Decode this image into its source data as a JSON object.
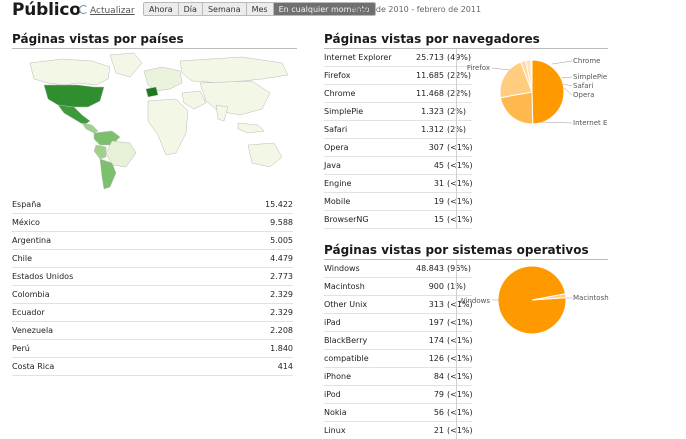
{
  "header": {
    "title": "Público",
    "refresh_label": "Actualizar",
    "range_buttons": [
      "Ahora",
      "Día",
      "Semana",
      "Mes",
      "En cualquier momento"
    ],
    "active_range": "En cualquier momento",
    "date_range": "mayo de 2010 - febrero de 2011"
  },
  "countries": {
    "title": "Páginas vistas por países",
    "rows": [
      {
        "name": "España",
        "value": "15.422"
      },
      {
        "name": "México",
        "value": "9.588"
      },
      {
        "name": "Argentina",
        "value": "5.005"
      },
      {
        "name": "Chile",
        "value": "4.479"
      },
      {
        "name": "Estados Unidos",
        "value": "2.773"
      },
      {
        "name": "Colombia",
        "value": "2.329"
      },
      {
        "name": "Ecuador",
        "value": "2.329"
      },
      {
        "name": "Venezuela",
        "value": "2.208"
      },
      {
        "name": "Perú",
        "value": "1.840"
      },
      {
        "name": "Costa Rica",
        "value": "414"
      }
    ]
  },
  "browsers": {
    "title": "Páginas vistas por navegadores",
    "rows": [
      {
        "name": "Internet Explorer",
        "count": "25.713",
        "pct": "(49%)"
      },
      {
        "name": "Firefox",
        "count": "11.685",
        "pct": "(22%)"
      },
      {
        "name": "Chrome",
        "count": "11.468",
        "pct": "(22%)"
      },
      {
        "name": "SimplePie",
        "count": "1.323",
        "pct": "(2%)"
      },
      {
        "name": "Safari",
        "count": "1.312",
        "pct": "(2%)"
      },
      {
        "name": "Opera",
        "count": "307",
        "pct": "(<1%)"
      },
      {
        "name": "Java",
        "count": "45",
        "pct": "(<1%)"
      },
      {
        "name": "Engine",
        "count": "31",
        "pct": "(<1%)"
      },
      {
        "name": "Mobile",
        "count": "19",
        "pct": "(<1%)"
      },
      {
        "name": "BrowserNG",
        "count": "15",
        "pct": "(<1%)"
      }
    ],
    "pie_labels": [
      "Firefox",
      "Chrome",
      "SimplePie",
      "Safari",
      "Opera",
      "Internet E"
    ]
  },
  "os": {
    "title": "Páginas vistas por sistemas operativos",
    "rows": [
      {
        "name": "Windows",
        "count": "48.843",
        "pct": "(96%)"
      },
      {
        "name": "Macintosh",
        "count": "900",
        "pct": "(1%)"
      },
      {
        "name": "Other Unix",
        "count": "313",
        "pct": "(<1%)"
      },
      {
        "name": "iPad",
        "count": "197",
        "pct": "(<1%)"
      },
      {
        "name": "BlackBerry",
        "count": "174",
        "pct": "(<1%)"
      },
      {
        "name": "compatible",
        "count": "126",
        "pct": "(<1%)"
      },
      {
        "name": "iPhone",
        "count": "84",
        "pct": "(<1%)"
      },
      {
        "name": "iPod",
        "count": "79",
        "pct": "(<1%)"
      },
      {
        "name": "Nokia",
        "count": "56",
        "pct": "(<1%)"
      },
      {
        "name": "Linux",
        "count": "21",
        "pct": "(<1%)"
      }
    ],
    "pie_labels": [
      "Windows",
      "Macintosh"
    ]
  },
  "chart_data": [
    {
      "type": "pie",
      "title": "",
      "categories": [
        "Internet Explorer",
        "Firefox",
        "Chrome",
        "SimplePie",
        "Safari",
        "Opera"
      ],
      "values": [
        25713,
        11685,
        11468,
        1323,
        1312,
        307
      ],
      "colors": [
        "#ff9900",
        "#ffb84d",
        "#ffcc80",
        "#ffd9a0",
        "#ffe3b5",
        "#ffedcc"
      ]
    },
    {
      "type": "pie",
      "title": "",
      "categories": [
        "Windows",
        "Macintosh"
      ],
      "values": [
        48843,
        900
      ],
      "colors": [
        "#ff9900",
        "#ffcc80"
      ]
    }
  ],
  "colors": {
    "pie_primary": "#ff9900",
    "map_ocean": "#ffffff",
    "map_land": "#f2f7e6",
    "map_high": "#2f8f2f",
    "map_mid": "#7cbf6c",
    "map_low": "#c9e4b8"
  }
}
